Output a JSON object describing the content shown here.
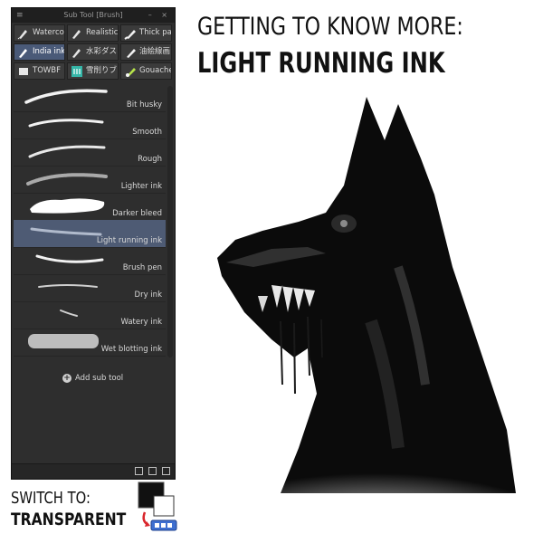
{
  "panel": {
    "title": "Sub Tool [Brush]",
    "menu_icon": "≡",
    "window_buttons": "– ×",
    "tabs": [
      {
        "label": "Waterco",
        "icon": "pen-nib-icon",
        "active": false
      },
      {
        "label": "Realistic",
        "icon": "pen-nib-icon",
        "active": false
      },
      {
        "label": "Thick pa",
        "icon": "brush-icon",
        "active": false
      },
      {
        "label": "India ink",
        "icon": "pen-nib-icon",
        "active": true
      },
      {
        "label": "水彩ダス",
        "icon": "pen-nib-icon",
        "active": false
      },
      {
        "label": "油絵線画",
        "icon": "brush-icon",
        "active": false
      },
      {
        "label": "TOWBF",
        "icon": "bold-brush-icon",
        "active": false
      },
      {
        "label": "雪削りブ",
        "icon": "teal-square-icon",
        "active": false
      },
      {
        "label": "Gouache",
        "icon": "gouache-brush-icon",
        "active": false
      }
    ],
    "brushes": [
      {
        "name": "Bit husky",
        "selected": false
      },
      {
        "name": "Smooth",
        "selected": false
      },
      {
        "name": "Rough",
        "selected": false
      },
      {
        "name": "Lighter ink",
        "selected": false
      },
      {
        "name": "Darker bleed",
        "selected": false
      },
      {
        "name": "Light running ink",
        "selected": true
      },
      {
        "name": "Brush pen",
        "selected": false
      },
      {
        "name": "Dry ink",
        "selected": false
      },
      {
        "name": "Watery ink",
        "selected": false
      },
      {
        "name": "Wet blotting ink",
        "selected": false
      }
    ],
    "add_subtool_label": "Add sub tool",
    "footer_icons": [
      "import-icon",
      "duplicate-icon",
      "trash-icon"
    ]
  },
  "heading": {
    "line1": "GETTING TO KNOW MORE:",
    "line2": "LIGHT RUNNING INK"
  },
  "switch": {
    "line1": "SWITCH TO:",
    "line2": "TRANSPARENT"
  },
  "colors": {
    "panel_bg": "#2e2e2e",
    "selected_row": "#4e5b74",
    "active_tab": "#4a5a78",
    "accent_red": "#d9262c",
    "transparent_swatch_blue": "#3e6fd0"
  }
}
